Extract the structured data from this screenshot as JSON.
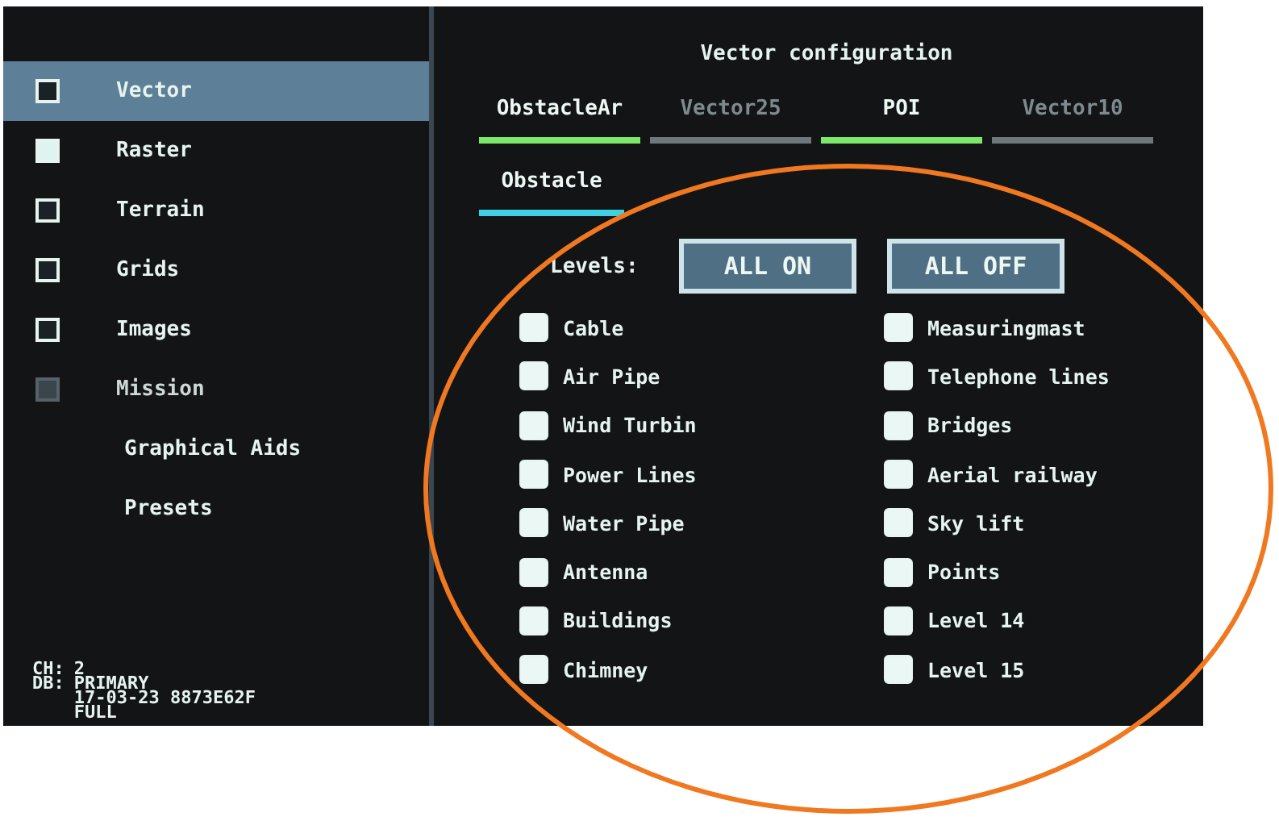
{
  "sidebar": {
    "items": [
      {
        "label": "Vector",
        "kind": "checkbox",
        "checked": false,
        "disabled": false,
        "selected": true
      },
      {
        "label": "Raster",
        "kind": "checkbox",
        "checked": true,
        "disabled": false,
        "selected": false
      },
      {
        "label": "Terrain",
        "kind": "checkbox",
        "checked": false,
        "disabled": false,
        "selected": false
      },
      {
        "label": "Grids",
        "kind": "checkbox",
        "checked": false,
        "disabled": false,
        "selected": false
      },
      {
        "label": "Images",
        "kind": "checkbox",
        "checked": false,
        "disabled": false,
        "selected": false
      },
      {
        "label": "Mission",
        "kind": "checkbox",
        "checked": false,
        "disabled": true,
        "selected": false
      },
      {
        "label": "Graphical Aids",
        "kind": "link",
        "selected": false
      },
      {
        "label": "Presets",
        "kind": "link",
        "selected": false
      }
    ],
    "status": {
      "labels": [
        "CH:",
        "DB:"
      ],
      "values": [
        "2",
        "PRIMARY",
        "17-03-23 8873E62F",
        "FULL"
      ]
    }
  },
  "panel": {
    "title": "Vector configuration",
    "tabs": [
      {
        "label": "ObstacleAr",
        "selected": true
      },
      {
        "label": "Vector25",
        "selected": false
      },
      {
        "label": "POI",
        "selected": true
      },
      {
        "label": "Vector10",
        "selected": false
      }
    ],
    "subtabs": [
      {
        "label": "Obstacle",
        "selected": true
      }
    ],
    "levels": {
      "label": "Levels:",
      "buttons": [
        "ALL ON",
        "ALL OFF"
      ],
      "items": [
        {
          "label": "Cable",
          "checked": true
        },
        {
          "label": "Air Pipe",
          "checked": true
        },
        {
          "label": "Wind Turbin",
          "checked": true
        },
        {
          "label": "Power Lines",
          "checked": true
        },
        {
          "label": "Water Pipe",
          "checked": true
        },
        {
          "label": "Antenna",
          "checked": true
        },
        {
          "label": "Buildings",
          "checked": true
        },
        {
          "label": "Chimney",
          "checked": true
        },
        {
          "label": "Measuringmast",
          "checked": true
        },
        {
          "label": "Telephone lines",
          "checked": true
        },
        {
          "label": "Bridges",
          "checked": true
        },
        {
          "label": "Aerial railway",
          "checked": true
        },
        {
          "label": "Sky lift",
          "checked": true
        },
        {
          "label": "Points",
          "checked": true
        },
        {
          "label": "Level 14",
          "checked": true
        },
        {
          "label": "Level 15",
          "checked": true
        }
      ]
    }
  },
  "annotation": {
    "kind": "ellipse",
    "color": "#f07820"
  }
}
